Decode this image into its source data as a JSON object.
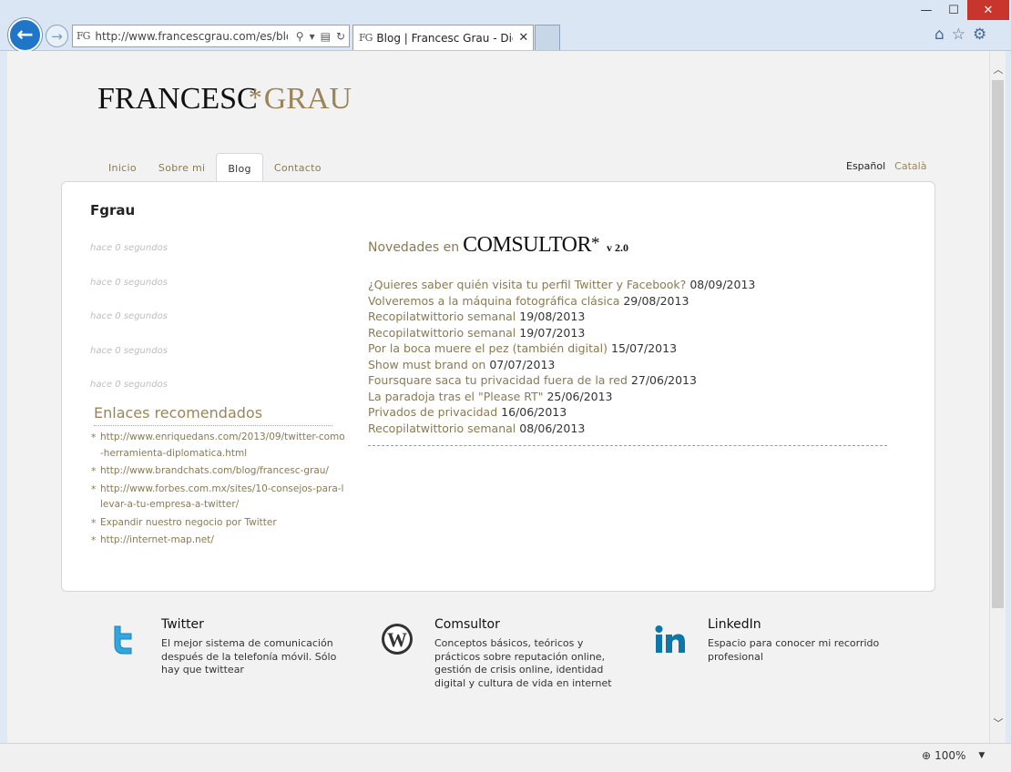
{
  "browser": {
    "address_favicon": "FG",
    "url": "http://www.francescgrau.com/es/blog/",
    "tab_favicon": "FG",
    "tab_title": "Blog | Francesc Grau - Digit...",
    "zoom": "100%"
  },
  "site": {
    "logo_part1": "FRANCESC",
    "logo_part2": "GRAU",
    "nav": [
      "Inicio",
      "Sobre mi",
      "Blog",
      "Contacto"
    ],
    "active_nav": "Blog",
    "lang_es": "Español",
    "lang_ca": "Català"
  },
  "sidebar": {
    "title": "Fgrau",
    "tweets": [
      "hace 0 segundos",
      "hace 0 segundos",
      "hace 0 segundos",
      "hace 0 segundos",
      "hace 0 segundos"
    ],
    "links_title": "Enlaces recomendados",
    "links": [
      "http://www.enriquedans.com/2013/09/twitter-como-herramienta-diplomatica.html",
      "http://www.brandchats.com/blog/francesc-grau/",
      "http://www.forbes.com.mx/sites/10-consejos-para-llevar-a-tu-empresa-a-twitter/",
      "Expandir nuestro negocio por Twitter",
      "http://internet-map.net/"
    ]
  },
  "news": {
    "label": "Novedades en",
    "brand": "COMSULTOR",
    "version": "v 2.0",
    "items": [
      {
        "title": "¿Quieres saber quién visita tu perfil Twitter y Facebook?",
        "date": "08/09/2013"
      },
      {
        "title": "Volveremos a la máquina fotográfica clásica",
        "date": "29/08/2013"
      },
      {
        "title": "Recopilatwittorio semanal",
        "date": "19/08/2013"
      },
      {
        "title": "Recopilatwittorio semanal",
        "date": "19/07/2013"
      },
      {
        "title": "Por la boca muere el pez (también digital)",
        "date": "15/07/2013"
      },
      {
        "title": "Show must brand on",
        "date": "07/07/2013"
      },
      {
        "title": "Foursquare saca tu privacidad fuera de la red",
        "date": "27/06/2013"
      },
      {
        "title": "La paradoja tras el \"Please RT\"",
        "date": "25/06/2013"
      },
      {
        "title": "Privados de privacidad",
        "date": "16/06/2013"
      },
      {
        "title": "Recopilatwittorio semanal",
        "date": "08/06/2013"
      }
    ]
  },
  "footer": [
    {
      "icon": "twitter-icon",
      "title": "Twitter",
      "desc": "El mejor sistema de comunicación después de la telefonía móvil. Sólo hay que twittear"
    },
    {
      "icon": "wordpress-icon",
      "title": "Comsultor",
      "desc": "Conceptos básicos, teóricos y prácticos sobre reputación online, gestión de crisis online, identidad digital y cultura de vida en internet"
    },
    {
      "icon": "linkedin-icon",
      "title": "LinkedIn",
      "desc": "Espacio para conocer mi recorrido profesional"
    }
  ],
  "colors": {
    "accent": "#9a8558",
    "twitter": "#2fa8e0",
    "linkedin": "#0e76a8",
    "wordpress": "#333333"
  }
}
